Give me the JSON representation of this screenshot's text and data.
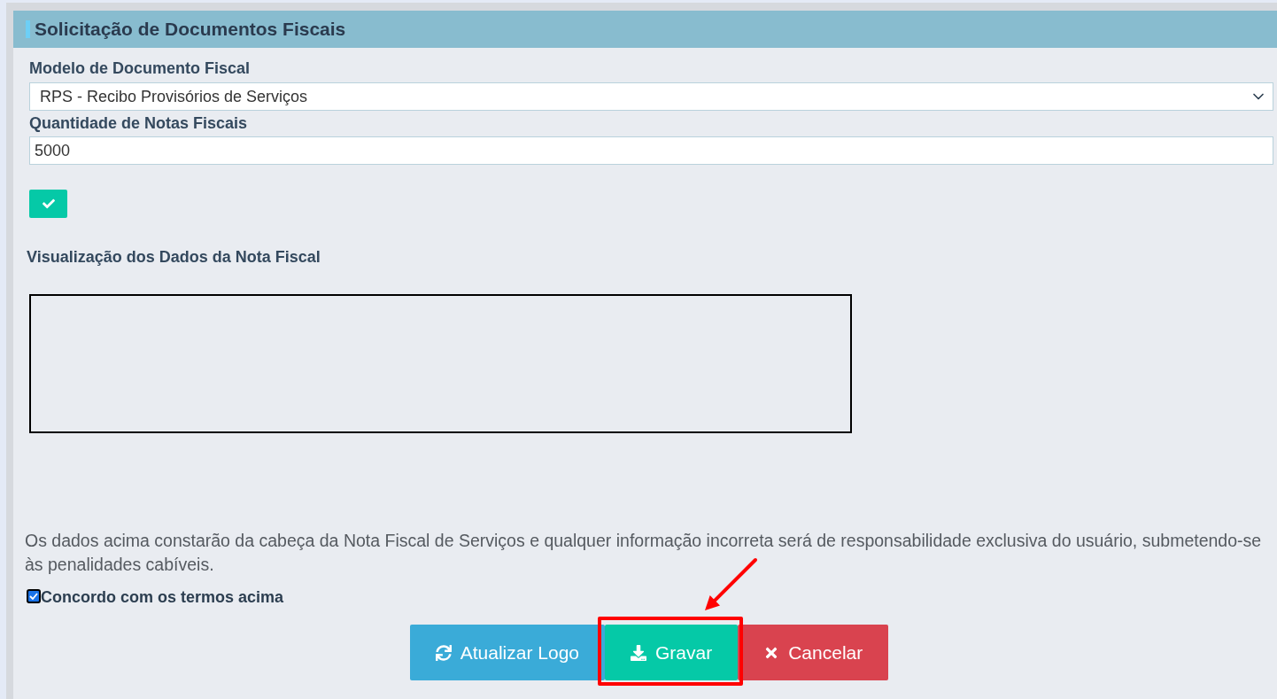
{
  "panel": {
    "title": "Solicitação de Documentos Fiscais"
  },
  "fields": [
    {
      "kind": "select",
      "label": "Modelo de Documento Fiscal",
      "value": "RPS - Recibo Provisórios de Serviços"
    },
    {
      "kind": "input",
      "label": "Quantidade de Notas Fiscais",
      "value": "5000"
    }
  ],
  "preview": {
    "title": "Visualização dos Dados da Nota Fiscal"
  },
  "notice": "Os dados acima constarão da cabeça da Nota Fiscal de Serviços e qualquer informação incorreta será de responsabilidade exclusiva do usuário, submetendo-se às penalidades cabíveis.",
  "agreement": {
    "label": "Concordo com os termos acima",
    "checked": true
  },
  "buttons": [
    {
      "kind": "refresh",
      "label": "Atualizar Logo",
      "highlighted": false
    },
    {
      "kind": "save",
      "label": "Gravar",
      "highlighted": true
    },
    {
      "kind": "cancel",
      "label": "Cancelar",
      "highlighted": false
    }
  ]
}
